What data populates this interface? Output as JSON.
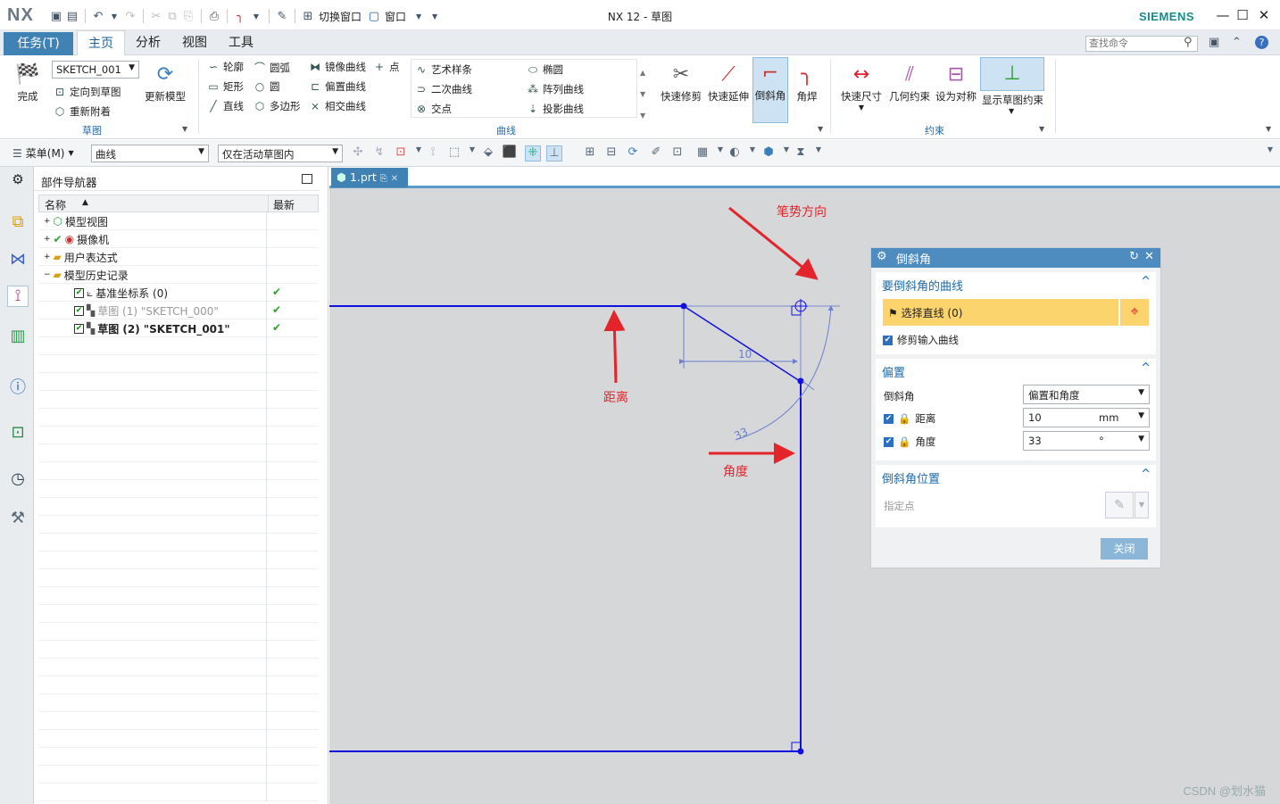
{
  "app": {
    "logo": "NX",
    "window_title": "NX 12 - 草图",
    "brand": "SIEMENS"
  },
  "qat": {
    "switch_window": "切换窗口",
    "window": "窗口"
  },
  "tabs": {
    "task": "任务(T)",
    "home": "主页",
    "analysis": "分析",
    "view": "视图",
    "tools": "工具"
  },
  "search": {
    "placeholder": "查找命令"
  },
  "ribbon": {
    "sketch_group": {
      "finish": "完成",
      "sketch_name": "SKETCH_001",
      "orient": "定向到草图",
      "reattach": "重新附着",
      "update_model": "更新模型",
      "label": "草图"
    },
    "curve_group": {
      "profile": "轮廓",
      "arc": "圆弧",
      "rect": "矩形",
      "circle": "圆",
      "line": "直线",
      "polygon": "多边形",
      "mirror": "镜像曲线",
      "point": "点",
      "offset": "偏置曲线",
      "intersect": "相交曲线",
      "spline": "艺术样条",
      "ellipse": "椭圆",
      "conic": "二次曲线",
      "pattern": "阵列曲线",
      "intersection_pt": "交点",
      "project": "投影曲线",
      "quick_trim": "快速修剪",
      "quick_extend": "快速延伸",
      "chamfer": "倒斜角",
      "fillet": "角焊",
      "label": "曲线"
    },
    "constraint_group": {
      "rapid_dim": "快速尺寸",
      "geo_con": "几何约束",
      "make_ref": "设为对称",
      "show_con": "显示草图约束",
      "label": "约束"
    }
  },
  "toolbar2": {
    "menu": "菜单(M)",
    "filter": "曲线",
    "scope": "仅在活动草图内"
  },
  "navigator": {
    "title": "部件导航器",
    "col_name": "名称",
    "col_latest": "最新",
    "rows": [
      {
        "label": "模型视图"
      },
      {
        "label": "摄像机"
      },
      {
        "label": "用户表达式"
      },
      {
        "label": "模型历史记录"
      },
      {
        "label": "基准坐标系 (0)"
      },
      {
        "label": "草图 (1) \"SKETCH_000\""
      },
      {
        "label": "草图 (2) \"SKETCH_001\""
      }
    ]
  },
  "doc_tab": "1.prt",
  "sketch": {
    "dim_distance": "10",
    "dim_angle": "33"
  },
  "annotations": {
    "stroke_dir": "笔势方向",
    "distance": "距离",
    "angle": "角度"
  },
  "dialog": {
    "title": "倒斜角",
    "section_curves": "要倒斜角的曲线",
    "select_line": "选择直线 (0)",
    "trim_input": "修剪输入曲线",
    "section_offset": "偏置",
    "chamfer_label": "倒斜角",
    "chamfer_mode": "偏置和角度",
    "distance_label": "距离",
    "distance_value": "10",
    "distance_unit": "mm",
    "angle_label": "角度",
    "angle_value": "33",
    "angle_unit": "°",
    "section_position": "倒斜角位置",
    "specify_point": "指定点",
    "close": "关闭"
  },
  "watermark": "CSDN @划水猫"
}
